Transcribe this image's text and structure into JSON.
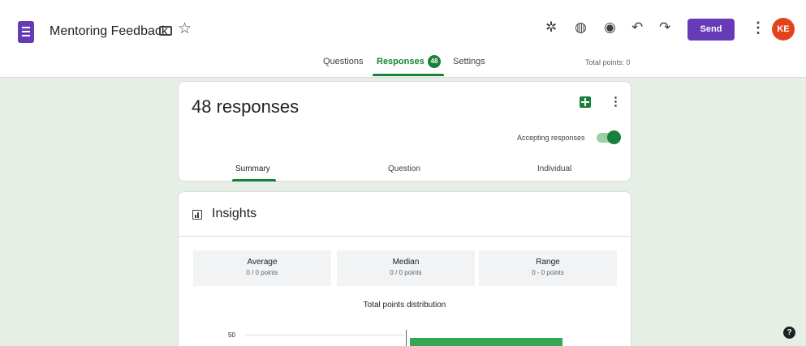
{
  "header": {
    "title": "Mentoring Feedback",
    "send_label": "Send",
    "avatar_initials": "KE",
    "icons": [
      "forms-icon",
      "folder-icon",
      "star-icon",
      "addons-icon",
      "palette-icon",
      "preview-icon",
      "undo-icon",
      "redo-icon",
      "more-icon"
    ]
  },
  "tabs": {
    "questions": "Questions",
    "responses": "Responses",
    "responses_count": "48",
    "settings": "Settings",
    "total_points": "Total points: 0"
  },
  "responses_card": {
    "count_text": "48 responses",
    "accepting_label": "Accepting responses",
    "accepting_on": true,
    "subtabs": [
      "Summary",
      "Question",
      "Individual"
    ],
    "active_subtab": "Summary"
  },
  "insights": {
    "title": "Insights",
    "stats": [
      {
        "label": "Average",
        "value": "0 / 0 points"
      },
      {
        "label": "Median",
        "value": "0 / 0 points"
      },
      {
        "label": "Range",
        "value": "0 - 0 points"
      }
    ],
    "distribution_title": "Total points distribution",
    "axis_top_tick": "50"
  },
  "colors": {
    "brand": "#673ab7",
    "accent": "#188038",
    "background": "#e5efe6",
    "avatar": "#e2431f"
  }
}
